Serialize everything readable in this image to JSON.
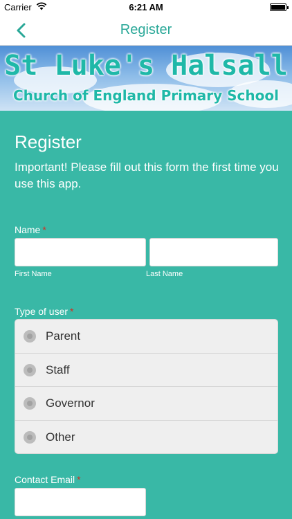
{
  "status_bar": {
    "carrier": "Carrier",
    "time": "6:21 AM"
  },
  "nav": {
    "title": "Register",
    "back_icon": "chevron-left-icon"
  },
  "banner": {
    "line1": "St Luke's Halsall",
    "line2": "Church of England Primary School"
  },
  "form": {
    "heading": "Register",
    "intro": "Important! Please fill out this form the first time you use this app.",
    "name": {
      "label": "Name",
      "required_mark": "*",
      "first_value": "",
      "last_value": "",
      "first_sublabel": "First Name",
      "last_sublabel": "Last Name"
    },
    "user_type": {
      "label": "Type of user",
      "required_mark": "*",
      "options": [
        "Parent",
        "Staff",
        "Governor",
        "Other"
      ]
    },
    "email": {
      "label": "Contact Email",
      "required_mark": "*",
      "value": ""
    }
  },
  "colors": {
    "background": "#39b8a6",
    "accent": "#2aa898",
    "required": "#d62b1f"
  }
}
